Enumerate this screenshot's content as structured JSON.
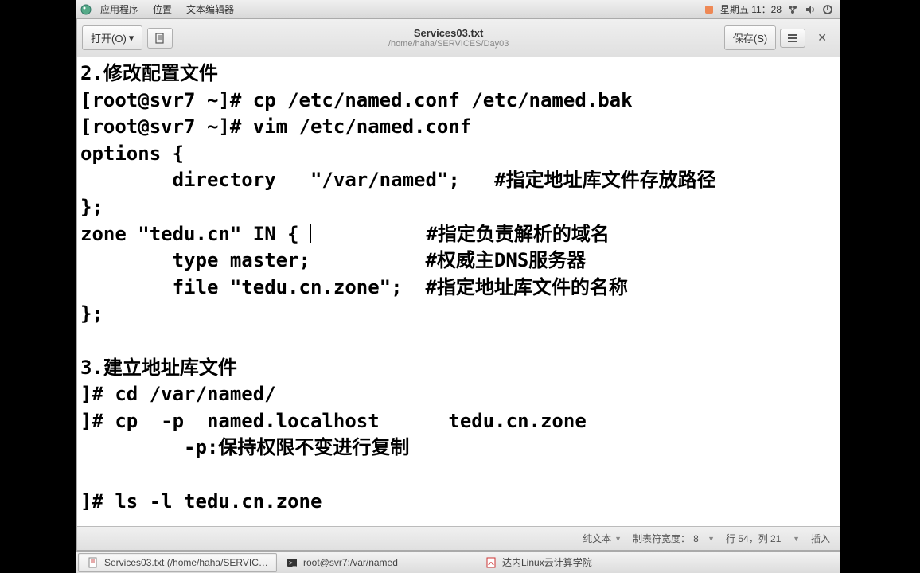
{
  "panel": {
    "apps": "应用程序",
    "places": "位置",
    "text_editor": "文本编辑器",
    "datetime": "星期五 11：28"
  },
  "toolbar": {
    "open": "打开(O)",
    "save": "保存(S)"
  },
  "window": {
    "title": "Services03.txt",
    "path": "/home/haha/SERVICES/Day03"
  },
  "editor": {
    "content": "2.修改配置文件\n[root@svr7 ~]# cp /etc/named.conf /etc/named.bak\n[root@svr7 ~]# vim /etc/named.conf\noptions {\n        directory   \"/var/named\";   #指定地址库文件存放路径\n};\nzone \"tedu.cn\" IN { |          #指定负责解析的域名\n        type master;          #权威主DNS服务器\n        file \"tedu.cn.zone\";  #指定地址库文件的名称\n};\n\n3.建立地址库文件\n]# cd /var/named/\n]# cp  -p  named.localhost      tedu.cn.zone\n         -p:保持权限不变进行复制\n\n]# ls -l tedu.cn.zone"
  },
  "status": {
    "syntax": "纯文本",
    "tab_width_label": "制表符宽度：",
    "tab_width_value": "8",
    "line_col": "行 54，列 21",
    "ins": "插入"
  },
  "taskbar": {
    "items": [
      {
        "label": "Services03.txt (/home/haha/SERVIC…"
      },
      {
        "label": "root@svr7:/var/named"
      },
      {
        "label": "达内Linux云计算学院"
      }
    ]
  }
}
